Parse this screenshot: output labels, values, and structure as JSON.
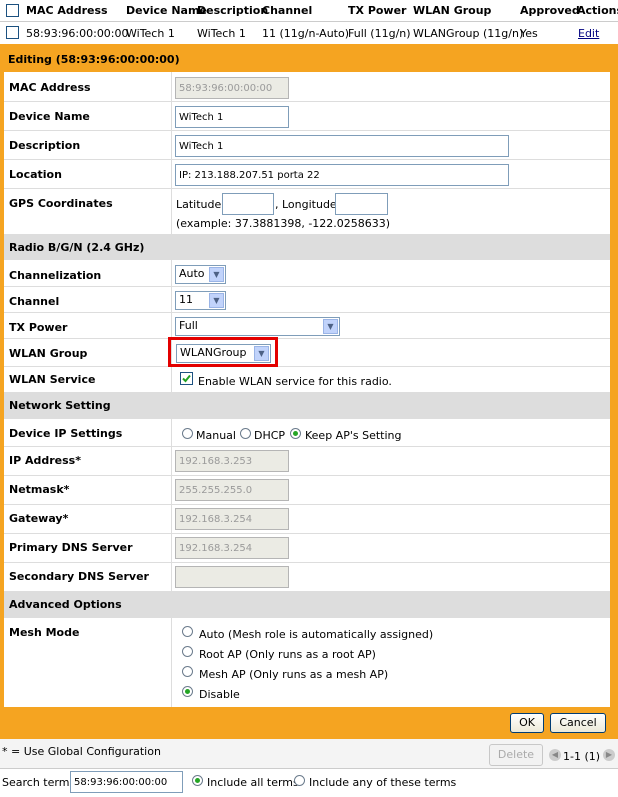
{
  "table": {
    "headers": {
      "mac": "MAC Address",
      "device_name": "Device Name",
      "description": "Description",
      "channel": "Channel",
      "tx_power": "TX Power",
      "wlan_group": "WLAN Group",
      "approved": "Approved",
      "actions": "Actions"
    },
    "row": {
      "mac": "58:93:96:00:00:00",
      "device_name": "WiTech 1",
      "description": "WiTech 1",
      "channel": "11 (11g/n-Auto)",
      "tx_power": "Full (11g/n)",
      "wlan_group": "WLANGroup (11g/n)",
      "approved": "Yes",
      "edit_link": "Edit"
    }
  },
  "editing": {
    "title": "Editing (58:93:96:00:00:00)",
    "mac_label": "MAC Address",
    "mac_value": "58:93:96:00:00:00",
    "device_name_label": "Device Name",
    "device_name_value": "WiTech 1",
    "description_label": "Description",
    "description_value": "WiTech 1",
    "location_label": "Location",
    "location_value": "IP: 213.188.207.51 porta 22",
    "gps_label": "GPS Coordinates",
    "latitude_label": "Latitude",
    "longitude_label": ", Longitude",
    "gps_example": "(example: 37.3881398, -122.0258633)",
    "radio_section": "Radio B/G/N (2.4 GHz)",
    "channelization_label": "Channelization",
    "channelization_value": "Auto",
    "channel_label": "Channel",
    "channel_value": "11",
    "tx_power_label": "TX Power",
    "tx_power_value": "Full",
    "wlan_group_label": "WLAN Group",
    "wlan_group_value": "WLANGroup",
    "wlan_service_label": "WLAN Service",
    "wlan_service_text": "Enable WLAN service for this radio.",
    "network_section": "Network Setting",
    "device_ip_label": "Device IP Settings",
    "ip_options": [
      "Manual",
      "DHCP",
      "Keep AP's Setting"
    ],
    "ip_address_label": "IP Address*",
    "ip_address_value": "192.168.3.253",
    "netmask_label": "Netmask*",
    "netmask_value": "255.255.255.0",
    "gateway_label": "Gateway*",
    "gateway_value": "192.168.3.254",
    "primary_dns_label": "Primary DNS Server",
    "primary_dns_value": "192.168.3.254",
    "secondary_dns_label": "Secondary DNS Server",
    "secondary_dns_value": "",
    "advanced_section": "Advanced Options",
    "mesh_mode_label": "Mesh Mode",
    "mesh_options": [
      "Auto (Mesh role is automatically assigned)",
      "Root AP (Only runs as a root AP)",
      "Mesh AP (Only runs as a mesh AP)",
      "Disable"
    ],
    "ok_label": "OK",
    "cancel_label": "Cancel"
  },
  "footer": {
    "global_note": "* = Use Global Configuration",
    "delete_label": "Delete",
    "pagination": "1-1 (1)",
    "search_label": "Search terms",
    "search_value": "58:93:96:00:00:00",
    "include_all": "Include all terms",
    "include_any": "Include any of these terms"
  },
  "colors": {
    "edit_panel": "#f5a421",
    "section_bg": "#dddddd",
    "highlight_box": "#e30000"
  }
}
